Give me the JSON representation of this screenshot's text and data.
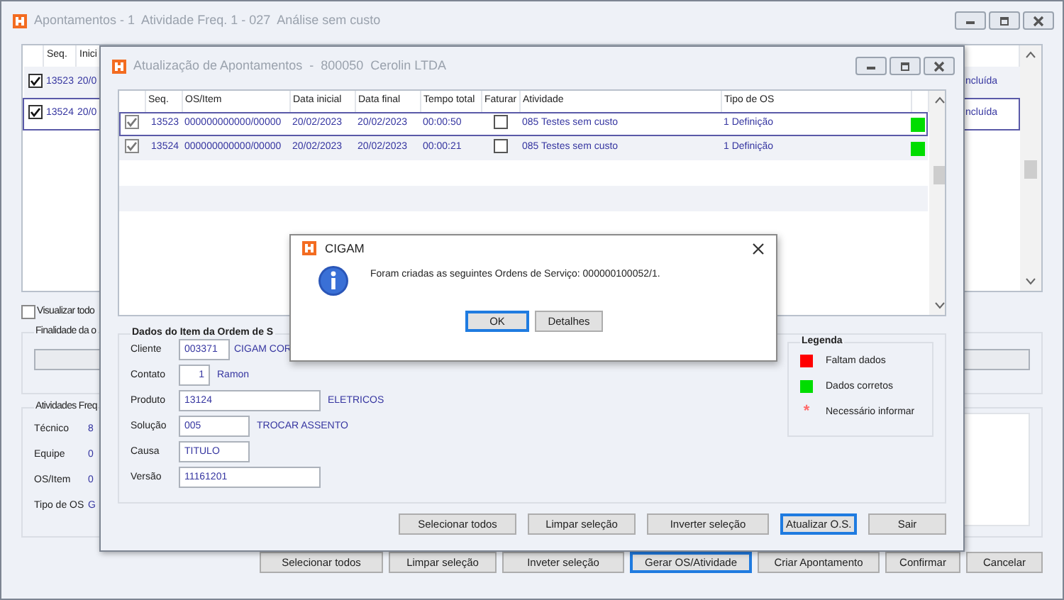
{
  "main_window": {
    "title": "Apontamentos - 1  Atividade Freq. 1 - 027  Análise sem custo",
    "grid": {
      "columns": [
        "Seq.",
        "Inici"
      ],
      "rows": [
        {
          "checked": true,
          "selected": false,
          "seq": "13523",
          "date": "20/0",
          "status": "ncluída"
        },
        {
          "checked": true,
          "selected": true,
          "seq": "13524",
          "date": "20/0",
          "status": "ncluída"
        }
      ]
    },
    "view_all": {
      "label": "Visualizar todo",
      "checked": false
    },
    "purpose_group": {
      "title": "Finalidade da o"
    },
    "activities_group": {
      "title": "Atividades Freq",
      "fields": [
        {
          "label": "Técnico",
          "value": "8"
        },
        {
          "label": "Equipe",
          "value": "0"
        },
        {
          "label": "OS/Item",
          "value": "0"
        },
        {
          "label": "Tipo de OS",
          "value": "G"
        }
      ]
    },
    "buttons": [
      {
        "label": "Selecionar todos",
        "focused": false
      },
      {
        "label": "Limpar seleção",
        "focused": false
      },
      {
        "label": "Inveter seleção",
        "focused": false
      },
      {
        "label": "Gerar OS/Atividade",
        "focused": true
      },
      {
        "label": "Criar Apontamento",
        "focused": false
      },
      {
        "label": "Confirmar",
        "focused": false
      },
      {
        "label": "Cancelar",
        "focused": false
      }
    ]
  },
  "update_window": {
    "title": "Atualização de Apontamentos  -  800050  Cerolin LTDA",
    "grid": {
      "columns": [
        "Seq.",
        "OS/Item",
        "Data inicial",
        "Data final",
        "Tempo total",
        "Faturar",
        "Atividade",
        "Tipo de OS"
      ],
      "rows": [
        {
          "checked": true,
          "selected": true,
          "seq": "13523",
          "os_item": "000000000000/00000",
          "start": "20/02/2023",
          "end": "20/02/2023",
          "total": "00:00:50",
          "bill": false,
          "activity": "085  Testes sem custo",
          "os_type": "1  Definição",
          "color": "#00dd00"
        },
        {
          "checked": true,
          "selected": false,
          "seq": "13524",
          "os_item": "000000000000/00000",
          "start": "20/02/2023",
          "end": "20/02/2023",
          "total": "00:00:21",
          "bill": false,
          "activity": "085  Testes sem custo",
          "os_type": "1  Definição",
          "color": "#00dd00"
        }
      ]
    },
    "item_group": {
      "title": "Dados do Item da Ordem de S",
      "fields": [
        {
          "label": "Cliente",
          "value": "003371",
          "description": "CIGAM COR",
          "kind": "short"
        },
        {
          "label": "Contato",
          "value": "1",
          "description": "Ramon",
          "kind": "narrow"
        },
        {
          "label": "Produto",
          "value": "13124",
          "description": "ELETRICOS",
          "kind": "wide"
        },
        {
          "label": "Solução",
          "value": "005",
          "description": "TROCAR ASSENTO",
          "kind": "medium"
        },
        {
          "label": "Causa",
          "value": "TITULO",
          "kind": "medium"
        },
        {
          "label": "Versão",
          "value": "11161201",
          "kind": "wide"
        }
      ]
    },
    "legend": {
      "title": "Legenda",
      "items": [
        {
          "kind": "swatch",
          "label": "Faltam dados",
          "color": "#ff0000"
        },
        {
          "kind": "swatch",
          "label": "Dados corretos",
          "color": "#00dd00"
        },
        {
          "kind": "asterisk",
          "marker": "*",
          "label": "Necessário informar",
          "color": "#ff6a6a"
        }
      ]
    },
    "buttons": [
      {
        "label": "Selecionar todos",
        "focused": false
      },
      {
        "label": "Limpar seleção",
        "focused": false
      },
      {
        "label": "Inverter seleção",
        "focused": false
      },
      {
        "label": "Atualizar O.S.",
        "focused": true
      },
      {
        "label": "Sair",
        "focused": false
      }
    ]
  },
  "dialog": {
    "title": "CIGAM",
    "message": "Foram criadas as seguintes Ordens de Serviço: 000000100052/1.",
    "buttons": [
      {
        "label": "OK",
        "focused": true
      },
      {
        "label": "Detalhes",
        "focused": false
      }
    ]
  }
}
